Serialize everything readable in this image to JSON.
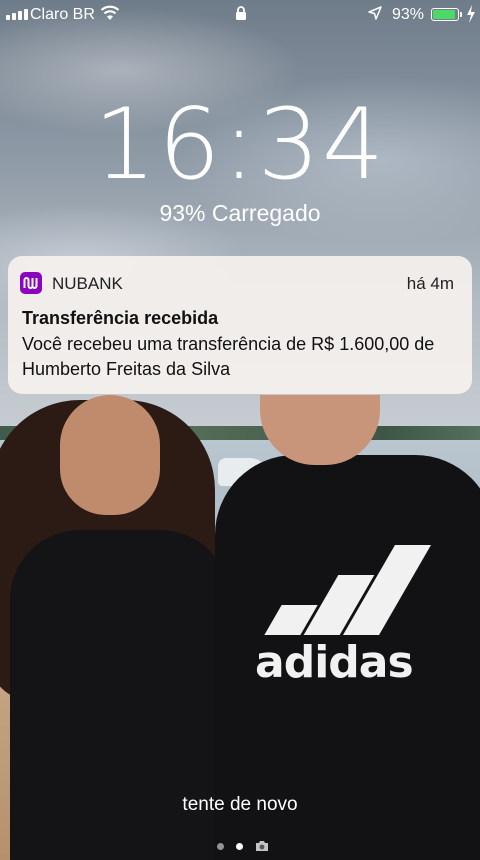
{
  "status_bar": {
    "carrier": "Claro BR",
    "battery_percent": "93%",
    "battery_level": 0.93,
    "battery_color": "#4cd964",
    "icons": [
      "signal-icon",
      "wifi-icon",
      "lock-icon",
      "location-icon",
      "battery-icon",
      "charging-icon"
    ]
  },
  "lock_screen": {
    "time": "16:34",
    "charging_status": "93% Carregado",
    "hint": "tente de novo"
  },
  "notification": {
    "app_name": "NUBANK",
    "app_icon": "nubank-icon",
    "app_color": "#8a05be",
    "time": "há 4m",
    "title": "Transferência recebida",
    "body": "Você recebeu uma transferência de R$ 1.600,00 de Humberto Freitas da Silva"
  },
  "wallpaper": {
    "shirt_logo_text": "adidas"
  },
  "page_indicator": {
    "pages": 2,
    "active_index": 1,
    "camera_icon": "camera-icon"
  }
}
